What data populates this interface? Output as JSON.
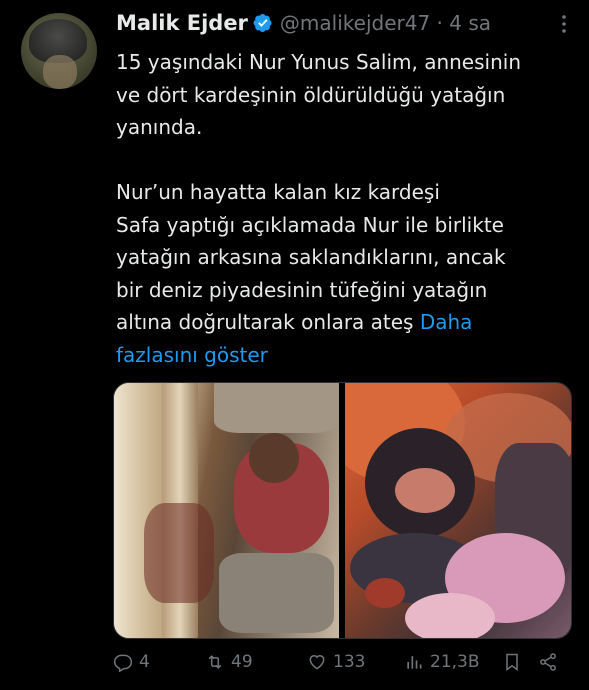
{
  "author": {
    "name": "Malik Ejder",
    "handle_time": "@malikejder47 · 4 sa"
  },
  "tweet": {
    "text": "15 yaşındaki Nur Yunus Salim, annesinin\nve dört kardeşinin öldürüldüğü yatağın\nyanında.\n\nNur’un hayatta kalan kız kardeşi\nSafa yaptığı açıklamada Nur ile birlikte\nyatağın arkasına saklandıklarını, ancak\nbir deniz piyadesinin tüfeğini yatağın\naltına doğrultarak onlara ateş ",
    "show_more": "Daha\nfazlasını göster"
  },
  "actions": {
    "replies": "4",
    "retweets": "49",
    "likes": "133",
    "views": "21,3B"
  },
  "icons": {
    "verified": "verified-badge-icon",
    "more": "more-options-icon",
    "reply": "reply-icon",
    "retweet": "retweet-icon",
    "like": "heart-icon",
    "views": "views-icon",
    "bookmark": "bookmark-icon",
    "share": "share-icon"
  },
  "colors": {
    "background": "#000000",
    "text": "#e7e9ea",
    "secondary": "#71767b",
    "link": "#1d9bf0"
  }
}
